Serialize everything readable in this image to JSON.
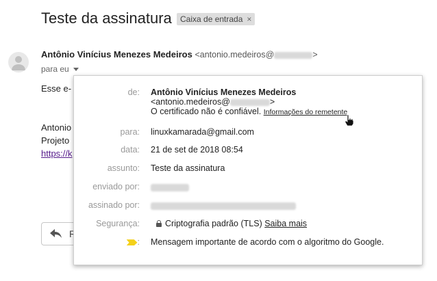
{
  "subject": {
    "title": "Teste da assinatura",
    "label": "Caixa de entrada",
    "label_remove": "×"
  },
  "sender": {
    "name": "Antônio Vinícius Menezes Medeiros",
    "email_prefix": "<antonio.medeiros@",
    "email_suffix": ">",
    "to_line": "para eu"
  },
  "body": {
    "line1": "Esse e-",
    "line2": "Antonio",
    "line3": "Projeto",
    "link": "https://k"
  },
  "reply": {
    "label": "R"
  },
  "details": {
    "from_label": "de:",
    "from_name": "Antônio Vinícius Menezes Medeiros",
    "from_email_prefix": "<antonio.medeiros@",
    "from_email_suffix": ">",
    "untrusted_text": "O certificado não é confiável.",
    "sender_info_link": "Informações do remetente",
    "to_label": "para:",
    "to_value": "linuxkamarada@gmail.com",
    "date_label": "data:",
    "date_value": "21 de set de 2018 08:54",
    "subject_label": "assunto:",
    "subject_value": "Teste da assinatura",
    "mailed_by_label": "enviado por:",
    "signed_by_label": "assinado por:",
    "security_label": "Segurança:",
    "security_value": "Criptografia padrão (TLS)",
    "security_link": "Saiba mais",
    "importance_suffix": ":",
    "importance_text": "Mensagem importante de acordo com o algoritmo do Google."
  },
  "colors": {
    "importance_marker": "#f4d11a",
    "link_visited": "#551a8b"
  }
}
